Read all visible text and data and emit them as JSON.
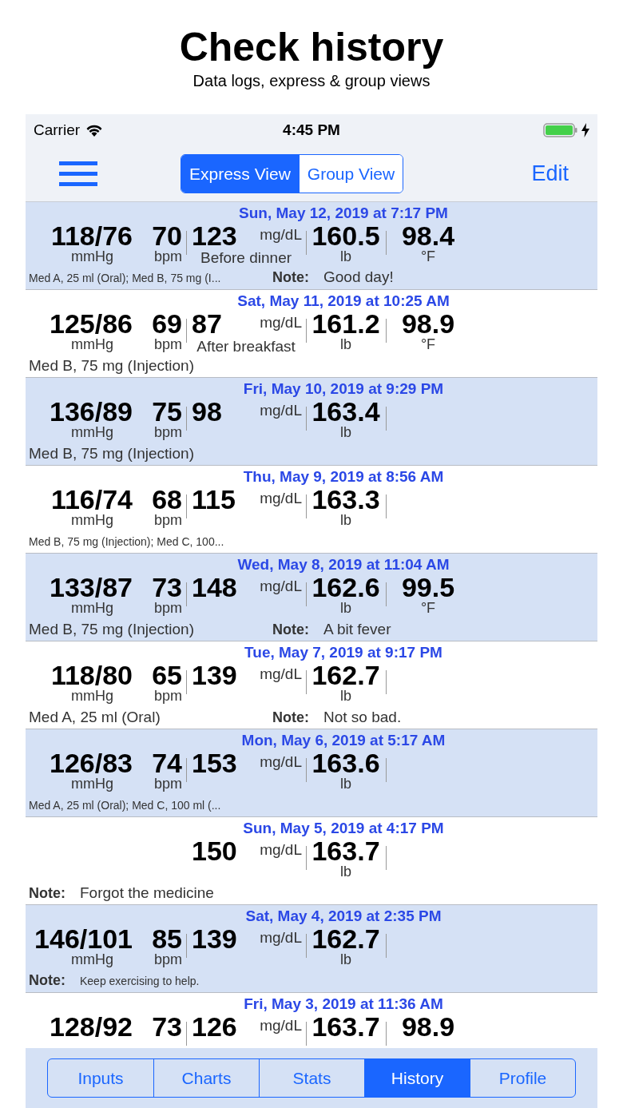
{
  "header": {
    "title": "Check history",
    "subtitle": "Data logs, express & group views"
  },
  "status_bar": {
    "carrier": "Carrier",
    "time": "4:45 PM"
  },
  "nav": {
    "views": [
      {
        "label": "Express View",
        "selected": true
      },
      {
        "label": "Group View",
        "selected": false
      }
    ],
    "edit": "Edit"
  },
  "rows": [
    {
      "date": "Sun, May 12, 2019 at 7:17 PM",
      "bp": "118/76",
      "bp_unit": "mmHg",
      "pulse": "70",
      "pulse_unit": "bpm",
      "glucose": "123",
      "glucose_unit": "mg/dL",
      "glucose_context": "Before dinner",
      "weight": "160.5",
      "weight_unit": "lb",
      "temp": "98.4",
      "temp_unit": "°F",
      "meds": "Med A, 25 ml (Oral); Med B, 75 mg (I...",
      "meds_small": true,
      "note_label": "Note:",
      "note": "Good day!",
      "note_small": false
    },
    {
      "date": "Sat, May 11, 2019 at 10:25 AM",
      "bp": "125/86",
      "bp_unit": "mmHg",
      "pulse": "69",
      "pulse_unit": "bpm",
      "glucose": "87",
      "glucose_unit": "mg/dL",
      "glucose_context": "After breakfast",
      "weight": "161.2",
      "weight_unit": "lb",
      "temp": "98.9",
      "temp_unit": "°F",
      "meds": "Med B, 75 mg (Injection)",
      "meds_small": false
    },
    {
      "date": "Fri, May 10, 2019 at 9:29 PM",
      "bp": "136/89",
      "bp_unit": "mmHg",
      "pulse": "75",
      "pulse_unit": "bpm",
      "glucose": "98",
      "glucose_unit": "mg/dL",
      "weight": "163.4",
      "weight_unit": "lb",
      "meds": "Med B, 75 mg (Injection)",
      "meds_small": false
    },
    {
      "date": "Thu, May 9, 2019 at 8:56 AM",
      "bp": "116/74",
      "bp_unit": "mmHg",
      "pulse": "68",
      "pulse_unit": "bpm",
      "glucose": "115",
      "glucose_unit": "mg/dL",
      "weight": "163.3",
      "weight_unit": "lb",
      "meds": "Med B, 75 mg (Injection); Med C, 100...",
      "meds_small": true
    },
    {
      "date": "Wed, May 8, 2019 at 11:04 AM",
      "bp": "133/87",
      "bp_unit": "mmHg",
      "pulse": "73",
      "pulse_unit": "bpm",
      "glucose": "148",
      "glucose_unit": "mg/dL",
      "weight": "162.6",
      "weight_unit": "lb",
      "temp": "99.5",
      "temp_unit": "°F",
      "meds": "Med B, 75 mg (Injection)",
      "meds_small": false,
      "note_label": "Note:",
      "note": "A bit fever",
      "note_small": false
    },
    {
      "date": "Tue, May 7, 2019 at 9:17 PM",
      "bp": "118/80",
      "bp_unit": "mmHg",
      "pulse": "65",
      "pulse_unit": "bpm",
      "glucose": "139",
      "glucose_unit": "mg/dL",
      "weight": "162.7",
      "weight_unit": "lb",
      "meds": "Med A, 25 ml (Oral)",
      "meds_small": false,
      "note_label": "Note:",
      "note": "Not so bad.",
      "note_small": false
    },
    {
      "date": "Mon, May 6, 2019 at 5:17 AM",
      "bp": "126/83",
      "bp_unit": "mmHg",
      "pulse": "74",
      "pulse_unit": "bpm",
      "glucose": "153",
      "glucose_unit": "mg/dL",
      "weight": "163.6",
      "weight_unit": "lb",
      "meds": "Med A, 25 ml (Oral); Med C, 100 ml (...",
      "meds_small": true
    },
    {
      "date": "Sun, May 5, 2019 at 4:17 PM",
      "glucose": "150",
      "glucose_unit": "mg/dL",
      "weight": "163.7",
      "weight_unit": "lb",
      "note_label": "Note:",
      "note": "Forgot the medicine",
      "note_small": false
    },
    {
      "date": "Sat, May 4, 2019 at 2:35 PM",
      "bp": "146/101",
      "bp_unit": "mmHg",
      "pulse": "85",
      "pulse_unit": "bpm",
      "glucose": "139",
      "glucose_unit": "mg/dL",
      "weight": "162.7",
      "weight_unit": "lb",
      "note_label": "Note:",
      "note": "Keep exercising to help.",
      "note_small": true
    },
    {
      "date": "Fri, May 3, 2019 at 11:36 AM",
      "bp": "128/92",
      "pulse": "73",
      "glucose": "126",
      "glucose_unit": "mg/dL",
      "weight": "163.7",
      "temp": "98.9"
    }
  ],
  "tabs": [
    {
      "label": "Inputs",
      "selected": false
    },
    {
      "label": "Charts",
      "selected": false
    },
    {
      "label": "Stats",
      "selected": false
    },
    {
      "label": "History",
      "selected": true
    },
    {
      "label": "Profile",
      "selected": false
    }
  ]
}
